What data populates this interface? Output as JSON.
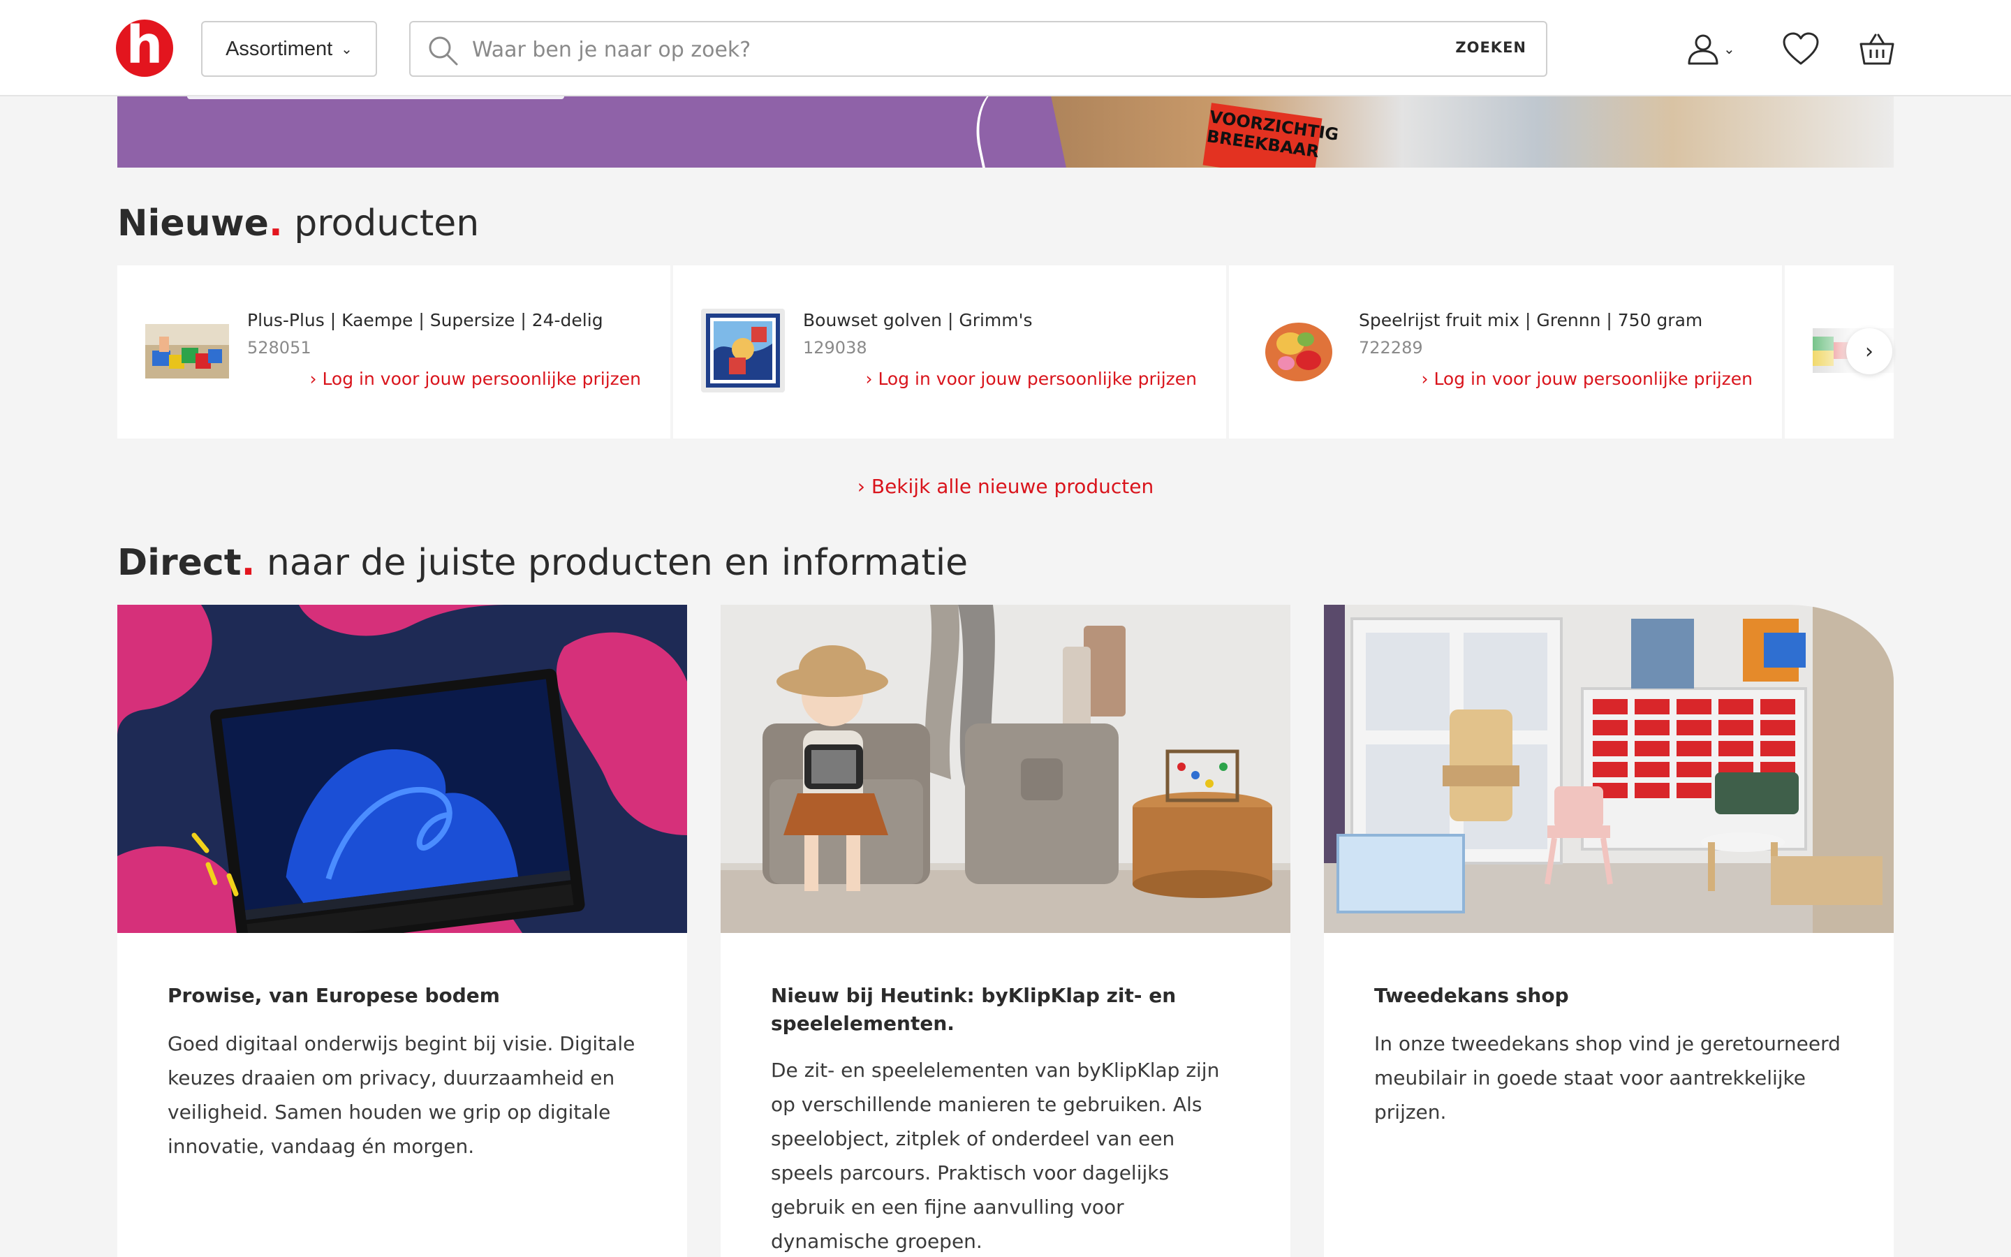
{
  "header": {
    "logo_letter": "h",
    "assortment_label": "Assortiment",
    "search_placeholder": "Waar ben je naar op zoek?",
    "search_button": "ZOEKEN",
    "icons": [
      "user-icon",
      "heart-icon",
      "basket-icon"
    ]
  },
  "banner": {
    "box_text": "VOORZICHTIG BREEKBAAR"
  },
  "new_products": {
    "title_bold": "Nieuwe",
    "title_dot": ".",
    "title_rest": " producten",
    "items": [
      {
        "name": "Plus-Plus | Kaempe | Supersize | 24-delig",
        "code": "528051",
        "login": "› Log in voor jouw persoonlijke prijzen"
      },
      {
        "name": "Bouwset golven | Grimm's",
        "code": "129038",
        "login": "› Log in voor jouw persoonlijke prijzen"
      },
      {
        "name": "Speelrijst fruit mix | Grennn | 750 gram",
        "code": "722289",
        "login": "› Log in voor jouw persoonlijke prijzen"
      }
    ],
    "next_label": "›",
    "view_all": "› Bekijk alle nieuwe producten"
  },
  "direct": {
    "title_bold": "Direct",
    "title_dot": ".",
    "title_rest": " naar de juiste producten en informatie",
    "cards": [
      {
        "title": "Prowise, van Europese bodem",
        "text": "Goed digitaal onderwijs begint bij visie. Digitale keuzes draaien om privacy, duurzaamheid en veiligheid. Samen houden we grip op digitale innovatie, vandaag én morgen."
      },
      {
        "title": "Nieuw bij Heutink: byKlipKlap zit- en speelelementen.",
        "text": "De zit- en speelelementen van byKlipKlap zijn op verschillende manieren te gebruiken. Als speelobject, zitplek of onderdeel van een speels parcours. Praktisch voor dagelijks gebruik en een fijne aanvulling voor dynamische groepen."
      },
      {
        "title": "Tweedekans shop",
        "text": "In onze tweedekans shop vind je geretourneerd meubilair in goede staat voor aantrekkelijke prijzen."
      }
    ]
  },
  "colors": {
    "brand_red": "#e3151e",
    "link_red": "#d9141c",
    "background": "#f4f4f4",
    "banner_purple": "#8f62a8",
    "prowise_pink": "#d6307a",
    "prowise_navy": "#1e2a55"
  }
}
